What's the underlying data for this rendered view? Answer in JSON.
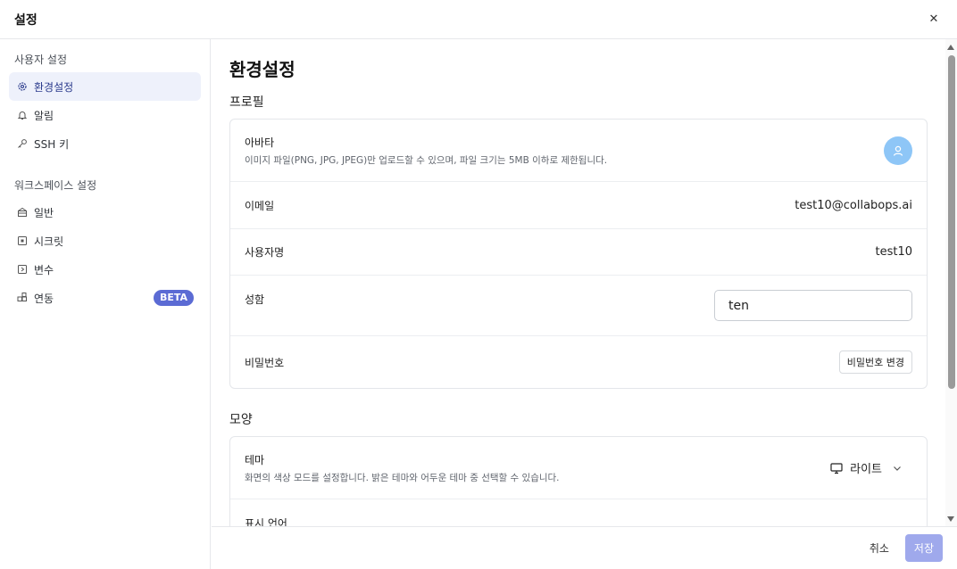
{
  "window": {
    "title": "설정"
  },
  "sidebar": {
    "user_section": "사용자 설정",
    "user_items": [
      {
        "label": "환경설정",
        "icon": "gear-icon"
      },
      {
        "label": "알림",
        "icon": "bell-icon"
      },
      {
        "label": "SSH 키",
        "icon": "key-icon"
      }
    ],
    "workspace_section": "워크스페이스 설정",
    "workspace_items": [
      {
        "label": "일반",
        "icon": "building-icon"
      },
      {
        "label": "시크릿",
        "icon": "secret-icon"
      },
      {
        "label": "변수",
        "icon": "variable-icon"
      },
      {
        "label": "연동",
        "icon": "integration-icon",
        "badge": "BETA"
      }
    ]
  },
  "main": {
    "title": "환경설정",
    "profile": {
      "title": "프로필",
      "avatar_label": "아바타",
      "avatar_desc": "이미지 파일(PNG, JPG, JPEG)만 업로드할 수 있으며, 파일 크기는 5MB 이하로 제한됩니다.",
      "email_label": "이메일",
      "email_value": "test10@collabops.ai",
      "username_label": "사용자명",
      "username_value": "test10",
      "lastname_label": "성함",
      "lastname_value": "ten",
      "password_label": "비밀번호",
      "password_button": "비밀번호 변경"
    },
    "appearance": {
      "title": "모양",
      "theme_label": "테마",
      "theme_desc": "화면의 색상 모드를 설정합니다. 밝은 테마와 어두운 테마 중 선택할 수 있습니다.",
      "theme_value": "라이트",
      "language_label": "표시 언어"
    }
  },
  "footer": {
    "cancel": "취소",
    "save": "저장"
  },
  "colors": {
    "accent": "#5b6bd4",
    "save_button": "#9fa9ec",
    "active_bg": "#eef1fb",
    "avatar": "#8ec6f7"
  }
}
